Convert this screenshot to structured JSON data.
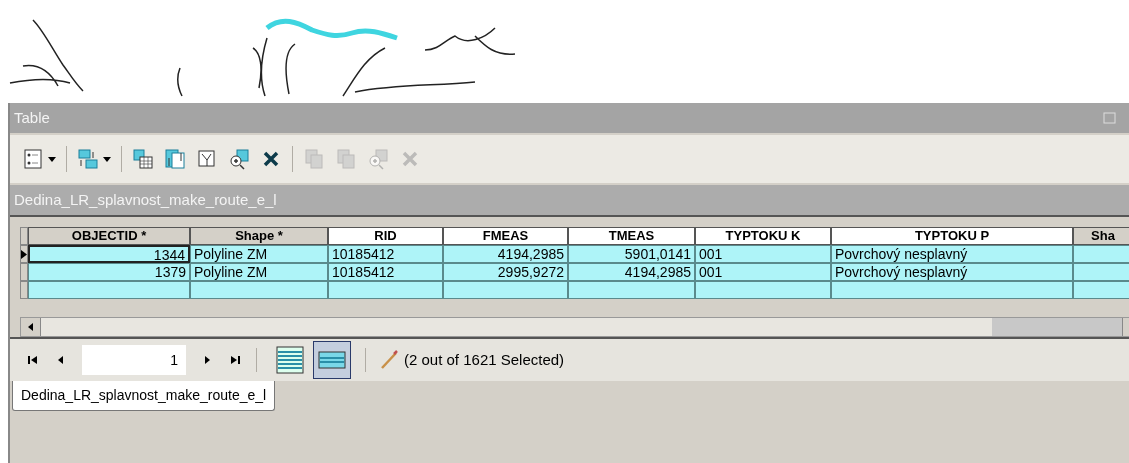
{
  "window": {
    "title": "Table"
  },
  "toolbar": [
    {
      "kind": "options",
      "dropdown": true,
      "disabled": false
    },
    {
      "kind": "relate",
      "dropdown": true,
      "disabled": false
    },
    {
      "kind": "select-attributes",
      "dropdown": false,
      "disabled": false
    },
    {
      "kind": "switch-selection",
      "dropdown": false,
      "disabled": false
    },
    {
      "kind": "clear-selection",
      "dropdown": false,
      "disabled": false
    },
    {
      "kind": "zoom-selected",
      "dropdown": false,
      "disabled": false
    },
    {
      "kind": "delete",
      "dropdown": false,
      "disabled": false
    },
    {
      "kind": "copy",
      "dropdown": false,
      "disabled": true
    },
    {
      "kind": "copy",
      "dropdown": false,
      "disabled": true
    },
    {
      "kind": "zoom-selected",
      "dropdown": false,
      "disabled": true
    },
    {
      "kind": "delete",
      "dropdown": false,
      "disabled": true
    }
  ],
  "table_name": "Dedina_LR_splavnost_make_route_e_l",
  "table": {
    "columns": [
      {
        "label": "OBJECTID *",
        "kind": "number"
      },
      {
        "label": "Shape *",
        "kind": "text"
      },
      {
        "label": "RID",
        "kind": "text"
      },
      {
        "label": "FMEAS",
        "kind": "number"
      },
      {
        "label": "TMEAS",
        "kind": "number"
      },
      {
        "label": "TYPTOKU K",
        "kind": "text"
      },
      {
        "label": "TYPTOKU P",
        "kind": "text"
      },
      {
        "label": "Sha",
        "kind": "text"
      }
    ],
    "rows": [
      {
        "current": true,
        "selected": true,
        "cells": [
          "1344",
          "Polyline ZM",
          "10185412",
          "4194,2985",
          "5901,0141",
          "001",
          "Povrchový nesplavný"
        ]
      },
      {
        "current": false,
        "selected": true,
        "cells": [
          "1379",
          "Polyline ZM",
          "10185412",
          "2995,9272",
          "4194,2985",
          "001",
          "Povrchový nesplavný"
        ]
      }
    ]
  },
  "navigator": {
    "record": "1",
    "views": [
      {
        "kind": "all",
        "selected": false
      },
      {
        "kind": "selected",
        "selected": true
      }
    ],
    "status": "(2 out of 1621 Selected)"
  },
  "tabs": [
    {
      "label": "Dedina_LR_splavnost_make_route_e_l",
      "selected": true
    }
  ]
}
